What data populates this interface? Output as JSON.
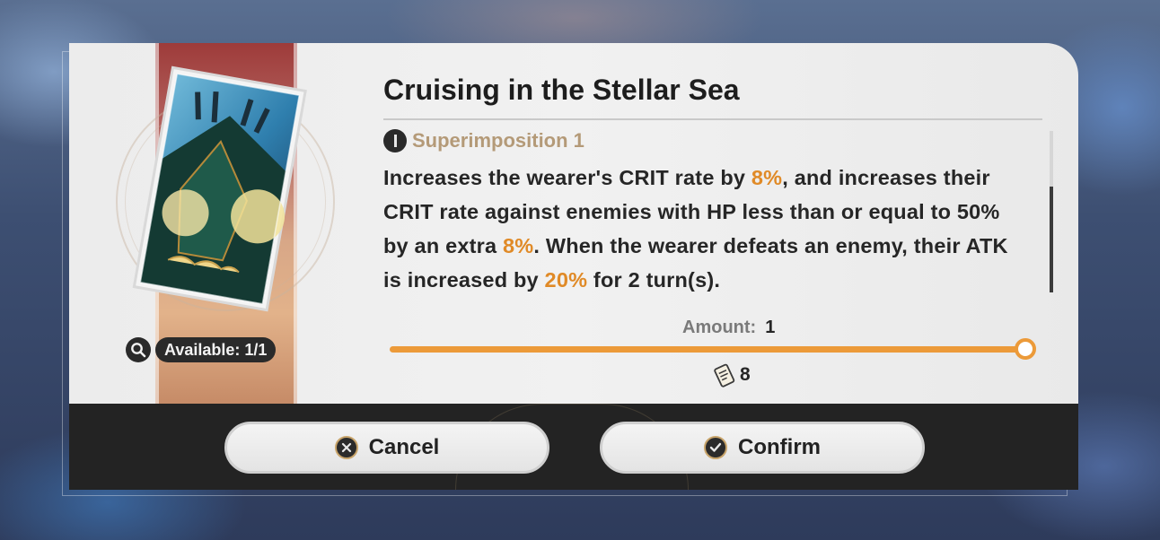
{
  "light_cone": {
    "title": "Cruising in the Stellar Sea",
    "superimposition_label": "Superimposition 1",
    "description": [
      {
        "text": "Increases the wearer's CRIT rate by ",
        "highlight": false
      },
      {
        "text": "8%",
        "highlight": true
      },
      {
        "text": ", and increases their CRIT rate against enemies with HP less than or equal to 50% by an extra ",
        "highlight": false
      },
      {
        "text": "8%",
        "highlight": true
      },
      {
        "text": ". When the wearer defeats an enemy, their ATK is increased by ",
        "highlight": false
      },
      {
        "text": "20%",
        "highlight": true
      },
      {
        "text": " for 2 turn(s).",
        "highlight": false
      }
    ]
  },
  "available": {
    "label": "Available: 1/1"
  },
  "amount": {
    "label": "Amount:",
    "value": "1",
    "slider_fraction": 1.0
  },
  "cost": {
    "icon": "ticket-icon",
    "value": "8"
  },
  "buttons": {
    "cancel_label": "Cancel",
    "confirm_label": "Confirm"
  },
  "colors": {
    "highlight": "#e08a27",
    "slider": "#ec9a39",
    "superimposition": "#b49a78"
  }
}
